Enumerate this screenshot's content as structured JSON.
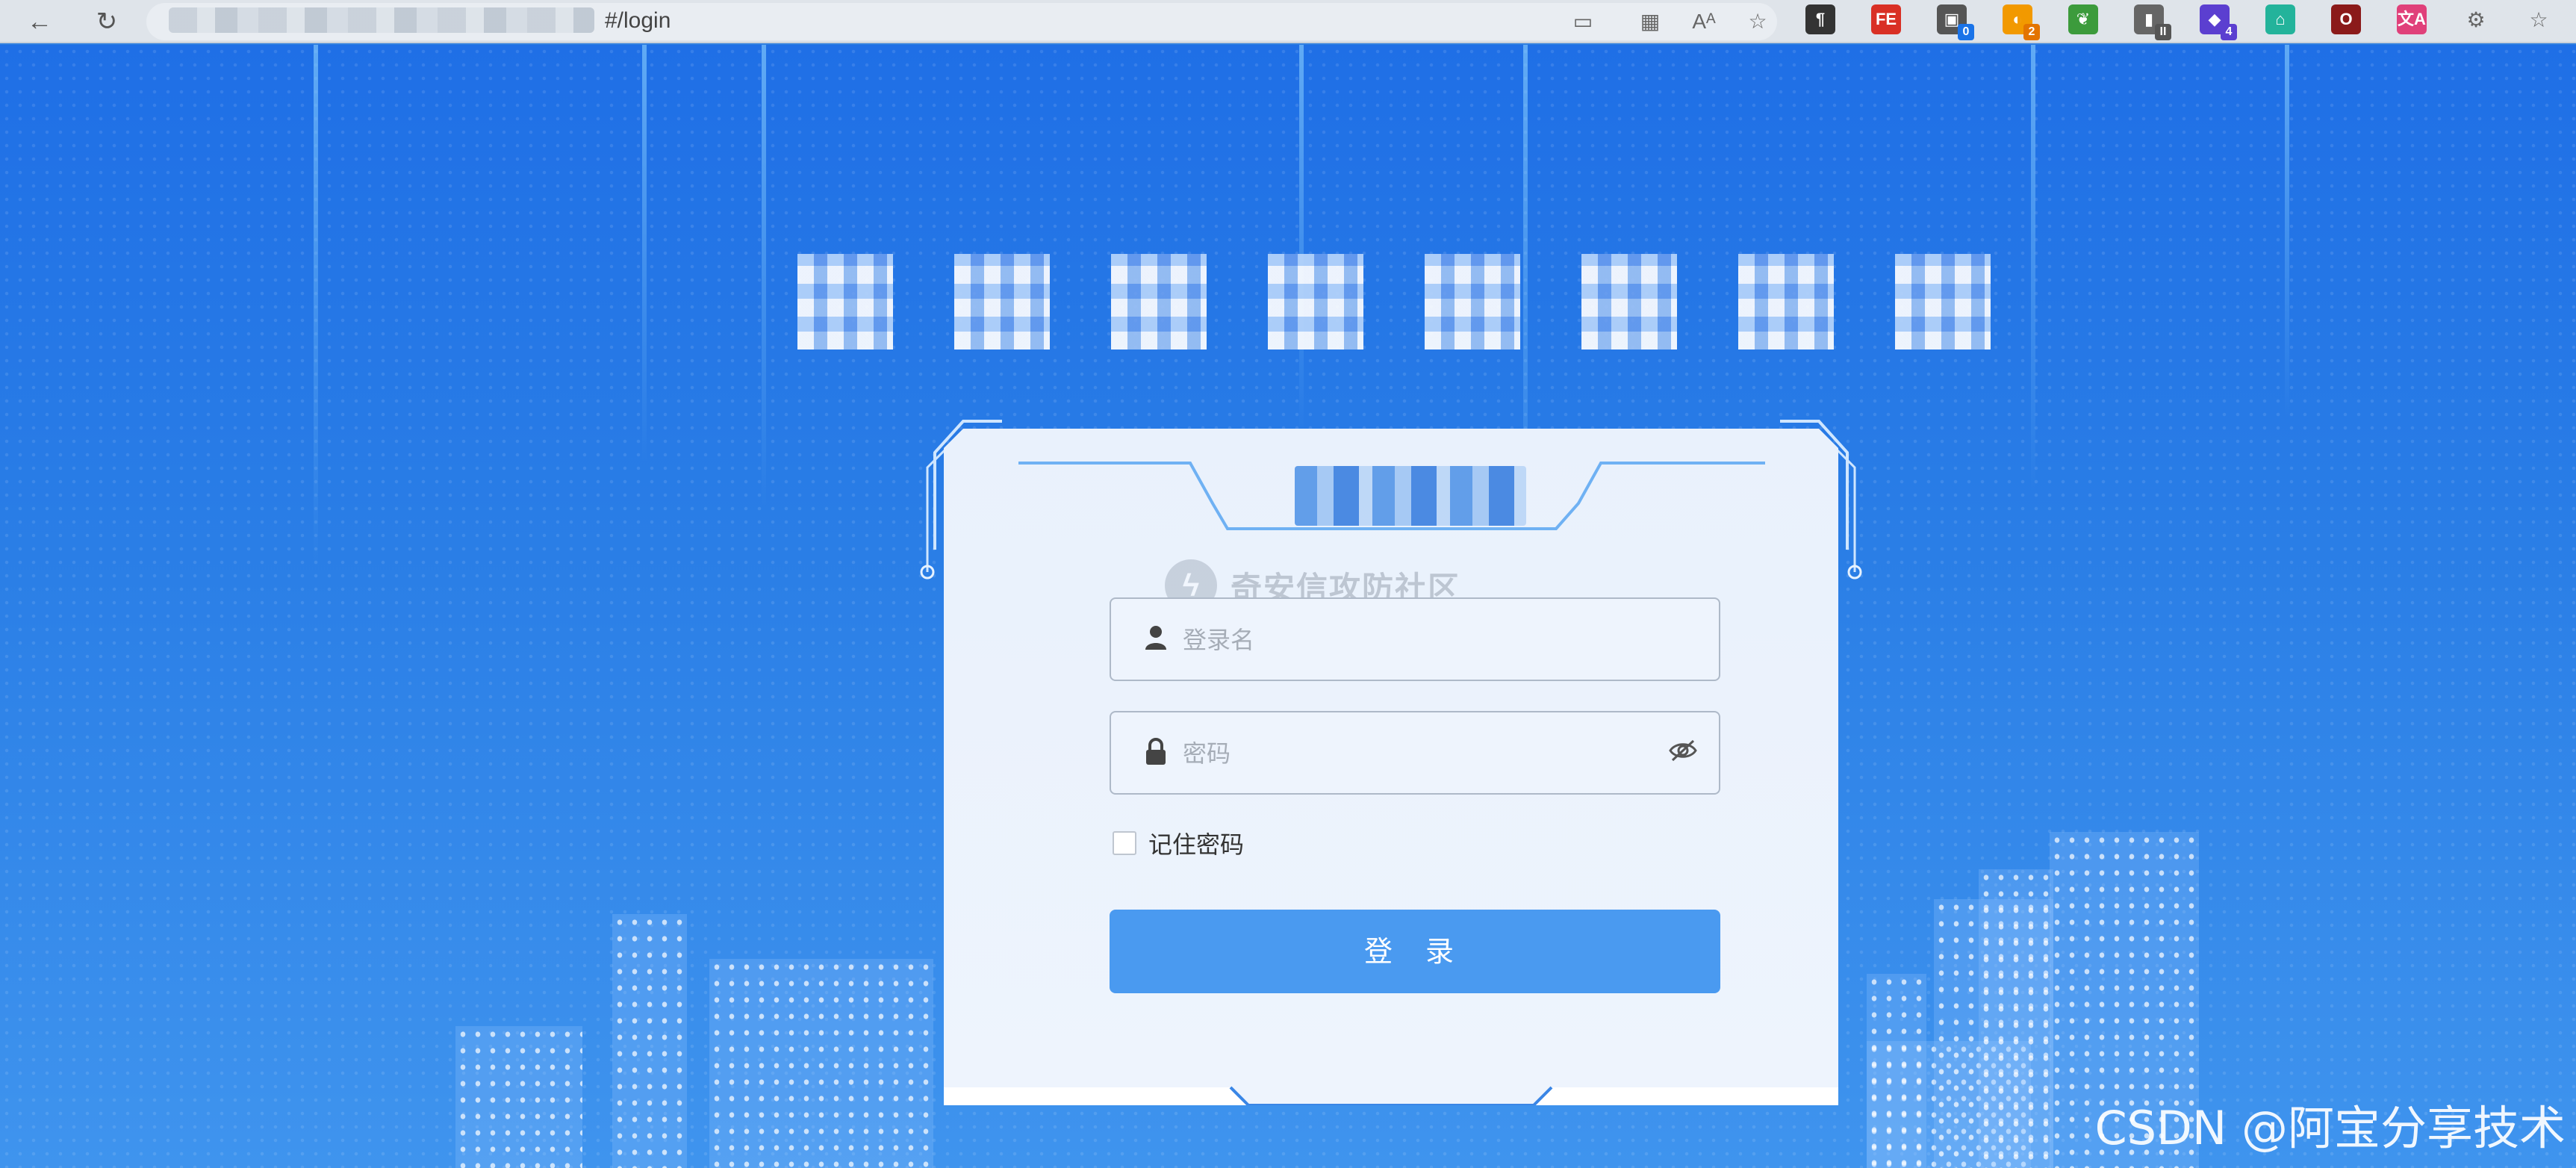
{
  "browser": {
    "url_visible": "#/login",
    "extensions": [
      {
        "name": "paragraph-extension-icon",
        "glyph": "¶",
        "color": "#333333",
        "badge": ""
      },
      {
        "name": "fe-extension-icon",
        "glyph": "FE",
        "color": "#d93025",
        "badge": ""
      },
      {
        "name": "camera-extension-icon",
        "glyph": "▣",
        "color": "#555555",
        "badge": "0",
        "badge_color": "#1a73e8"
      },
      {
        "name": "orange-extension-icon",
        "glyph": "◐",
        "color": "#f29900",
        "badge": "2",
        "badge_color": "#e37400"
      },
      {
        "name": "green-extension-icon",
        "glyph": "❦",
        "color": "#3c9b3c",
        "badge": ""
      },
      {
        "name": "film-extension-icon",
        "glyph": "▮",
        "color": "#666666",
        "badge": "II",
        "badge_color": "#555555"
      },
      {
        "name": "cube-extension-icon",
        "glyph": "◆",
        "color": "#5b3fd0",
        "badge": "4",
        "badge_color": "#5b3fd0"
      },
      {
        "name": "teal-extension-icon",
        "glyph": "⌂",
        "color": "#23b39b",
        "badge": ""
      },
      {
        "name": "dark-extension-icon",
        "glyph": "O",
        "color": "#8b1a1a",
        "badge": ""
      },
      {
        "name": "translate-extension-icon",
        "glyph": "文A",
        "color": "#e0407a",
        "badge": ""
      }
    ]
  },
  "login": {
    "username_placeholder": "登录名",
    "password_placeholder": "密码",
    "remember_label": "记住密码",
    "login_button": "登 录",
    "watermark_text": "奇安信攻防社区"
  },
  "footer_watermark": "CSDN @阿宝分享技术",
  "colors": {
    "accent": "#4a9af0",
    "background": "#2a7ee6",
    "card": "#eef4fd"
  }
}
